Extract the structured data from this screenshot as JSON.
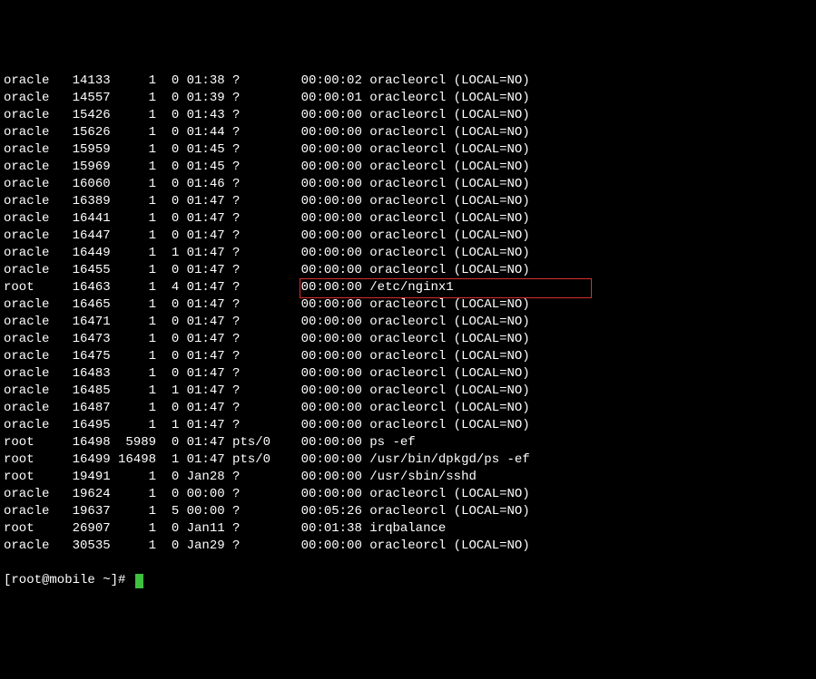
{
  "rows": [
    {
      "uid": "oracle",
      "pid": "14133",
      "ppid": "1",
      "c": "0",
      "stime": "01:38",
      "tty": "?",
      "time": "00:00:02",
      "cmd": "oracleorcl (LOCAL=NO)"
    },
    {
      "uid": "oracle",
      "pid": "14557",
      "ppid": "1",
      "c": "0",
      "stime": "01:39",
      "tty": "?",
      "time": "00:00:01",
      "cmd": "oracleorcl (LOCAL=NO)"
    },
    {
      "uid": "oracle",
      "pid": "15426",
      "ppid": "1",
      "c": "0",
      "stime": "01:43",
      "tty": "?",
      "time": "00:00:00",
      "cmd": "oracleorcl (LOCAL=NO)"
    },
    {
      "uid": "oracle",
      "pid": "15626",
      "ppid": "1",
      "c": "0",
      "stime": "01:44",
      "tty": "?",
      "time": "00:00:00",
      "cmd": "oracleorcl (LOCAL=NO)"
    },
    {
      "uid": "oracle",
      "pid": "15959",
      "ppid": "1",
      "c": "0",
      "stime": "01:45",
      "tty": "?",
      "time": "00:00:00",
      "cmd": "oracleorcl (LOCAL=NO)"
    },
    {
      "uid": "oracle",
      "pid": "15969",
      "ppid": "1",
      "c": "0",
      "stime": "01:45",
      "tty": "?",
      "time": "00:00:00",
      "cmd": "oracleorcl (LOCAL=NO)"
    },
    {
      "uid": "oracle",
      "pid": "16060",
      "ppid": "1",
      "c": "0",
      "stime": "01:46",
      "tty": "?",
      "time": "00:00:00",
      "cmd": "oracleorcl (LOCAL=NO)"
    },
    {
      "uid": "oracle",
      "pid": "16389",
      "ppid": "1",
      "c": "0",
      "stime": "01:47",
      "tty": "?",
      "time": "00:00:00",
      "cmd": "oracleorcl (LOCAL=NO)"
    },
    {
      "uid": "oracle",
      "pid": "16441",
      "ppid": "1",
      "c": "0",
      "stime": "01:47",
      "tty": "?",
      "time": "00:00:00",
      "cmd": "oracleorcl (LOCAL=NO)"
    },
    {
      "uid": "oracle",
      "pid": "16447",
      "ppid": "1",
      "c": "0",
      "stime": "01:47",
      "tty": "?",
      "time": "00:00:00",
      "cmd": "oracleorcl (LOCAL=NO)"
    },
    {
      "uid": "oracle",
      "pid": "16449",
      "ppid": "1",
      "c": "1",
      "stime": "01:47",
      "tty": "?",
      "time": "00:00:00",
      "cmd": "oracleorcl (LOCAL=NO)"
    },
    {
      "uid": "oracle",
      "pid": "16455",
      "ppid": "1",
      "c": "0",
      "stime": "01:47",
      "tty": "?",
      "time": "00:00:00",
      "cmd": "oracleorcl (LOCAL=NO)"
    },
    {
      "uid": "root",
      "pid": "16463",
      "ppid": "1",
      "c": "4",
      "stime": "01:47",
      "tty": "?",
      "time": "00:00:00",
      "cmd": "/etc/nginx1",
      "highlight": true
    },
    {
      "uid": "oracle",
      "pid": "16465",
      "ppid": "1",
      "c": "0",
      "stime": "01:47",
      "tty": "?",
      "time": "00:00:00",
      "cmd": "oracleorcl (LOCAL=NO)"
    },
    {
      "uid": "oracle",
      "pid": "16471",
      "ppid": "1",
      "c": "0",
      "stime": "01:47",
      "tty": "?",
      "time": "00:00:00",
      "cmd": "oracleorcl (LOCAL=NO)"
    },
    {
      "uid": "oracle",
      "pid": "16473",
      "ppid": "1",
      "c": "0",
      "stime": "01:47",
      "tty": "?",
      "time": "00:00:00",
      "cmd": "oracleorcl (LOCAL=NO)"
    },
    {
      "uid": "oracle",
      "pid": "16475",
      "ppid": "1",
      "c": "0",
      "stime": "01:47",
      "tty": "?",
      "time": "00:00:00",
      "cmd": "oracleorcl (LOCAL=NO)"
    },
    {
      "uid": "oracle",
      "pid": "16483",
      "ppid": "1",
      "c": "0",
      "stime": "01:47",
      "tty": "?",
      "time": "00:00:00",
      "cmd": "oracleorcl (LOCAL=NO)"
    },
    {
      "uid": "oracle",
      "pid": "16485",
      "ppid": "1",
      "c": "1",
      "stime": "01:47",
      "tty": "?",
      "time": "00:00:00",
      "cmd": "oracleorcl (LOCAL=NO)"
    },
    {
      "uid": "oracle",
      "pid": "16487",
      "ppid": "1",
      "c": "0",
      "stime": "01:47",
      "tty": "?",
      "time": "00:00:00",
      "cmd": "oracleorcl (LOCAL=NO)"
    },
    {
      "uid": "oracle",
      "pid": "16495",
      "ppid": "1",
      "c": "1",
      "stime": "01:47",
      "tty": "?",
      "time": "00:00:00",
      "cmd": "oracleorcl (LOCAL=NO)"
    },
    {
      "uid": "root",
      "pid": "16498",
      "ppid": "5989",
      "c": "0",
      "stime": "01:47",
      "tty": "pts/0",
      "time": "00:00:00",
      "cmd": "ps -ef"
    },
    {
      "uid": "root",
      "pid": "16499",
      "ppid": "16498",
      "c": "1",
      "stime": "01:47",
      "tty": "pts/0",
      "time": "00:00:00",
      "cmd": "/usr/bin/dpkgd/ps -ef"
    },
    {
      "uid": "root",
      "pid": "19491",
      "ppid": "1",
      "c": "0",
      "stime": "Jan28",
      "tty": "?",
      "time": "00:00:00",
      "cmd": "/usr/sbin/sshd"
    },
    {
      "uid": "oracle",
      "pid": "19624",
      "ppid": "1",
      "c": "0",
      "stime": "00:00",
      "tty": "?",
      "time": "00:00:00",
      "cmd": "oracleorcl (LOCAL=NO)"
    },
    {
      "uid": "oracle",
      "pid": "19637",
      "ppid": "1",
      "c": "5",
      "stime": "00:00",
      "tty": "?",
      "time": "00:05:26",
      "cmd": "oracleorcl (LOCAL=NO)"
    },
    {
      "uid": "root",
      "pid": "26907",
      "ppid": "1",
      "c": "0",
      "stime": "Jan11",
      "tty": "?",
      "time": "00:01:38",
      "cmd": "irqbalance"
    },
    {
      "uid": "oracle",
      "pid": "30535",
      "ppid": "1",
      "c": "0",
      "stime": "Jan29",
      "tty": "?",
      "time": "00:00:00",
      "cmd": "oracleorcl (LOCAL=NO)"
    }
  ],
  "prompt": "[root@mobile ~]# "
}
